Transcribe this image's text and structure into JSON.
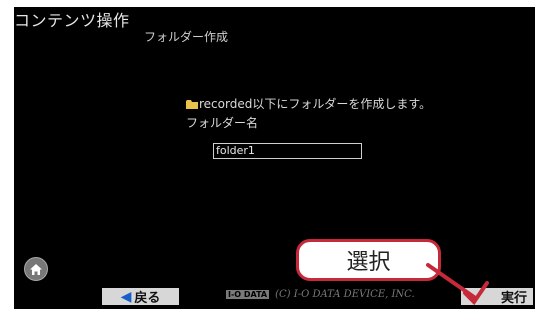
{
  "app": {
    "title": "コンテンツ操作"
  },
  "dialog": {
    "subtitle": "フォルダー作成",
    "message": "recorded以下にフォルダーを作成します。",
    "field_label": "フォルダー名",
    "field_value": "folder1"
  },
  "footer": {
    "back_label": "戻る",
    "exec_label": "実行",
    "brand_logo": "I-O DATA",
    "copyright": "(C) I-O DATA DEVICE, INC."
  },
  "callout": {
    "label": "選択"
  },
  "icons": {
    "home": "home-icon",
    "folder": "folder-icon",
    "back_arrow": "left-arrow-icon",
    "exec_check": "check-icon"
  },
  "colors": {
    "background": "#000000",
    "callout_border": "#c62a3a",
    "arrow": "#1a5ec8"
  }
}
